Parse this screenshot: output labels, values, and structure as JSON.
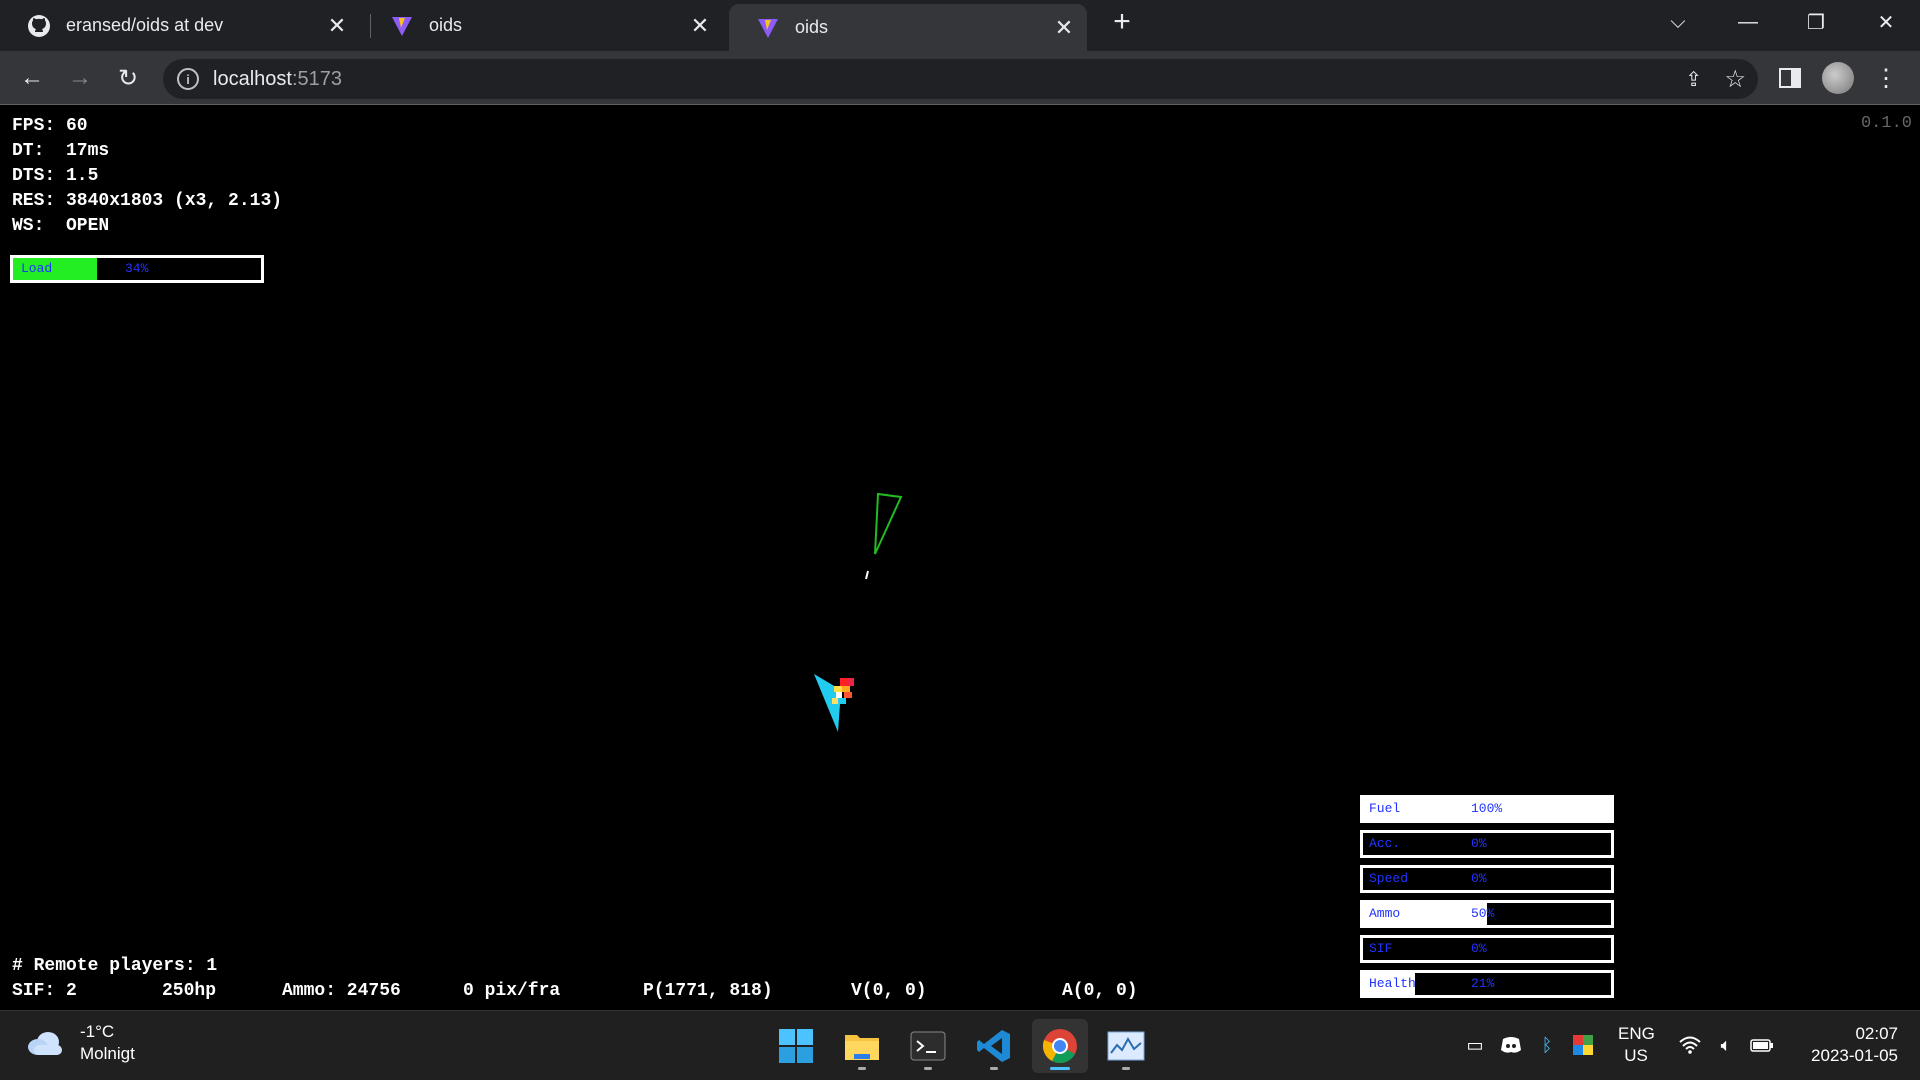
{
  "browser": {
    "tabs": [
      {
        "title": "eransed/oids at dev",
        "icon": "github-icon",
        "active": false
      },
      {
        "title": "oids",
        "icon": "vite-icon",
        "active": false
      },
      {
        "title": "oids",
        "icon": "vite-icon",
        "active": true
      }
    ],
    "url_host": "localhost",
    "url_port": ":5173"
  },
  "game": {
    "debug_lines": {
      "fps": "FPS: 60",
      "dt": "DT:  17ms",
      "dts": "DTS: 1.5",
      "res": "RES: 3840x1803 (x3, 2.13)",
      "ws": "WS:  OPEN"
    },
    "version": "0.1.0",
    "load": {
      "label": "Load",
      "percent_text": "34%",
      "value": 34
    },
    "stats": [
      {
        "label": "Fuel",
        "percent_text": "100%",
        "value": 100
      },
      {
        "label": "Acc.",
        "percent_text": "0%",
        "value": 0
      },
      {
        "label": "Speed",
        "percent_text": "0%",
        "value": 0
      },
      {
        "label": "Ammo",
        "percent_text": "50%",
        "value": 50
      },
      {
        "label": "SIF",
        "percent_text": "0%",
        "value": 0
      },
      {
        "label": "Health",
        "percent_text": "21%",
        "value": 21
      }
    ],
    "remote_players": "# Remote players: 1",
    "status": {
      "sif": "SIF: 2",
      "hp": "250hp",
      "ammo": "Ammo: 24756",
      "speed": "0 pix/fra",
      "position": "P(1771, 818)",
      "velocity": "V(0, 0)",
      "acceleration": "A(0, 0)"
    },
    "colors": {
      "remote_ship": "#22bb22",
      "player_ship": "#22ccee",
      "load_fill": "#22ee22",
      "bar_text": "#2233ff"
    }
  },
  "taskbar": {
    "weather_temp": "-1°C",
    "weather_desc": "Molnigt",
    "apps": [
      "start-icon",
      "file-explorer-icon",
      "terminal-icon",
      "vscode-icon",
      "chrome-icon",
      "resource-monitor-icon"
    ],
    "lang_1": "ENG",
    "lang_2": "US",
    "time": "02:07",
    "date": "2023-01-05"
  }
}
